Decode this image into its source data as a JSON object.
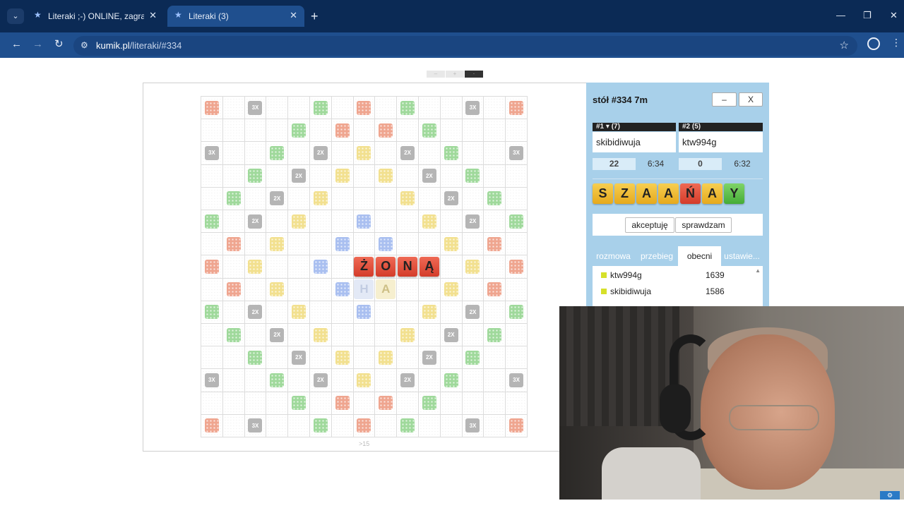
{
  "browser": {
    "tabs": [
      {
        "title": "Literaki ;-) ONLINE, zagraj - Kum",
        "active": false
      },
      {
        "title": "Literaki (3)",
        "active": true
      }
    ],
    "url_host": "kumik.pl",
    "url_path": "/literaki/#334"
  },
  "zoom": {
    "minus": "–",
    "plus": "+",
    "current": "·"
  },
  "board": {
    "size": 15,
    "footer": ">15",
    "bonus_layout": [
      "r..3..g.r.g..3..r",
      ""
    ],
    "rows": [
      [
        "r",
        "",
        "3X",
        "",
        "",
        "g",
        "",
        "r",
        "",
        "g",
        "",
        "",
        "3X",
        "",
        "r"
      ],
      [
        "",
        "",
        "",
        "",
        "g",
        "",
        "r",
        "",
        "r",
        "",
        "g",
        "",
        "",
        "",
        ""
      ],
      [
        "3X",
        "",
        "",
        "g",
        "",
        "2X",
        "",
        "y",
        "",
        "2X",
        "",
        "g",
        "",
        "",
        "3X"
      ],
      [
        "",
        "",
        "g",
        "",
        "2X",
        "",
        "y",
        "",
        "y",
        "",
        "2X",
        "",
        "g",
        "",
        ""
      ],
      [
        "",
        "g",
        "",
        "2X",
        "",
        "y",
        "",
        "",
        "",
        "y",
        "",
        "2X",
        "",
        "g",
        ""
      ],
      [
        "g",
        "",
        "2X",
        "",
        "y",
        "",
        "",
        "b",
        "",
        "",
        "y",
        "",
        "2X",
        "",
        "g"
      ],
      [
        "",
        "r",
        "",
        "y",
        "",
        "",
        "b",
        "",
        "b",
        "",
        "",
        "y",
        "",
        "r",
        ""
      ],
      [
        "r",
        "",
        "y",
        "",
        "",
        "b",
        "",
        "T:Ż",
        "T:O",
        "T:N",
        "T:Ą",
        "",
        "y",
        "",
        "r"
      ],
      [
        "",
        "r",
        "",
        "y",
        "",
        "",
        "b",
        "G:H",
        "G2:A",
        "",
        "",
        "y",
        "",
        "r",
        ""
      ],
      [
        "g",
        "",
        "2X",
        "",
        "y",
        "",
        "",
        "b",
        "",
        "",
        "y",
        "",
        "2X",
        "",
        "g"
      ],
      [
        "",
        "g",
        "",
        "2X",
        "",
        "y",
        "",
        "",
        "",
        "y",
        "",
        "2X",
        "",
        "g",
        ""
      ],
      [
        "",
        "",
        "g",
        "",
        "2X",
        "",
        "y",
        "",
        "y",
        "",
        "2X",
        "",
        "g",
        "",
        ""
      ],
      [
        "3X",
        "",
        "",
        "g",
        "",
        "2X",
        "",
        "y",
        "",
        "2X",
        "",
        "g",
        "",
        "",
        "3X"
      ],
      [
        "",
        "",
        "",
        "",
        "g",
        "",
        "r",
        "",
        "r",
        "",
        "g",
        "",
        "",
        "",
        ""
      ],
      [
        "r",
        "",
        "3X",
        "",
        "",
        "g",
        "",
        "r",
        "",
        "g",
        "",
        "",
        "3X",
        "",
        "r"
      ]
    ]
  },
  "side": {
    "table_title": "stół #334  7m",
    "minimize": "–",
    "close": "X",
    "players": [
      {
        "header": "#1 ▾ (7)",
        "name": "skibidiwuja",
        "score": "22",
        "time": "6:34"
      },
      {
        "header": "#2   (5)",
        "name": "ktw994g",
        "score": "0",
        "time": "6:32"
      }
    ],
    "rack": [
      {
        "letter": "S",
        "color": "y"
      },
      {
        "letter": "Z",
        "color": "y"
      },
      {
        "letter": "A",
        "color": "y"
      },
      {
        "letter": "A",
        "color": "y"
      },
      {
        "letter": "Ń",
        "color": "r"
      },
      {
        "letter": "A",
        "color": "y"
      },
      {
        "letter": "Y",
        "color": "g"
      }
    ],
    "accept_label": "akceptuję",
    "check_label": "sprawdzam",
    "tabs": [
      "rozmowa",
      "przebieg",
      "obecni",
      "ustawie..."
    ],
    "active_tab": "obecni",
    "present": [
      {
        "name": "ktw994g",
        "rank": "1639"
      },
      {
        "name": "skibidiwuja",
        "rank": "1586"
      }
    ]
  },
  "colors": {
    "tab_bar": "#0b2a55",
    "toolbar": "#1f4f8e",
    "side_panel": "#a8d0ea",
    "tile_red": "#d43c2a",
    "tile_yellow": "#e6a91c",
    "tile_green": "#45ac36"
  },
  "icons": [
    "star-favicon",
    "close-icon",
    "plus-icon",
    "back-icon",
    "forward-icon",
    "reload-icon",
    "site-info-icon",
    "bookmark-star-icon",
    "profile-icon",
    "more-icon",
    "minimize-icon",
    "maximize-icon",
    "close-window-icon"
  ],
  "webcam": {
    "badge": "⚙"
  }
}
